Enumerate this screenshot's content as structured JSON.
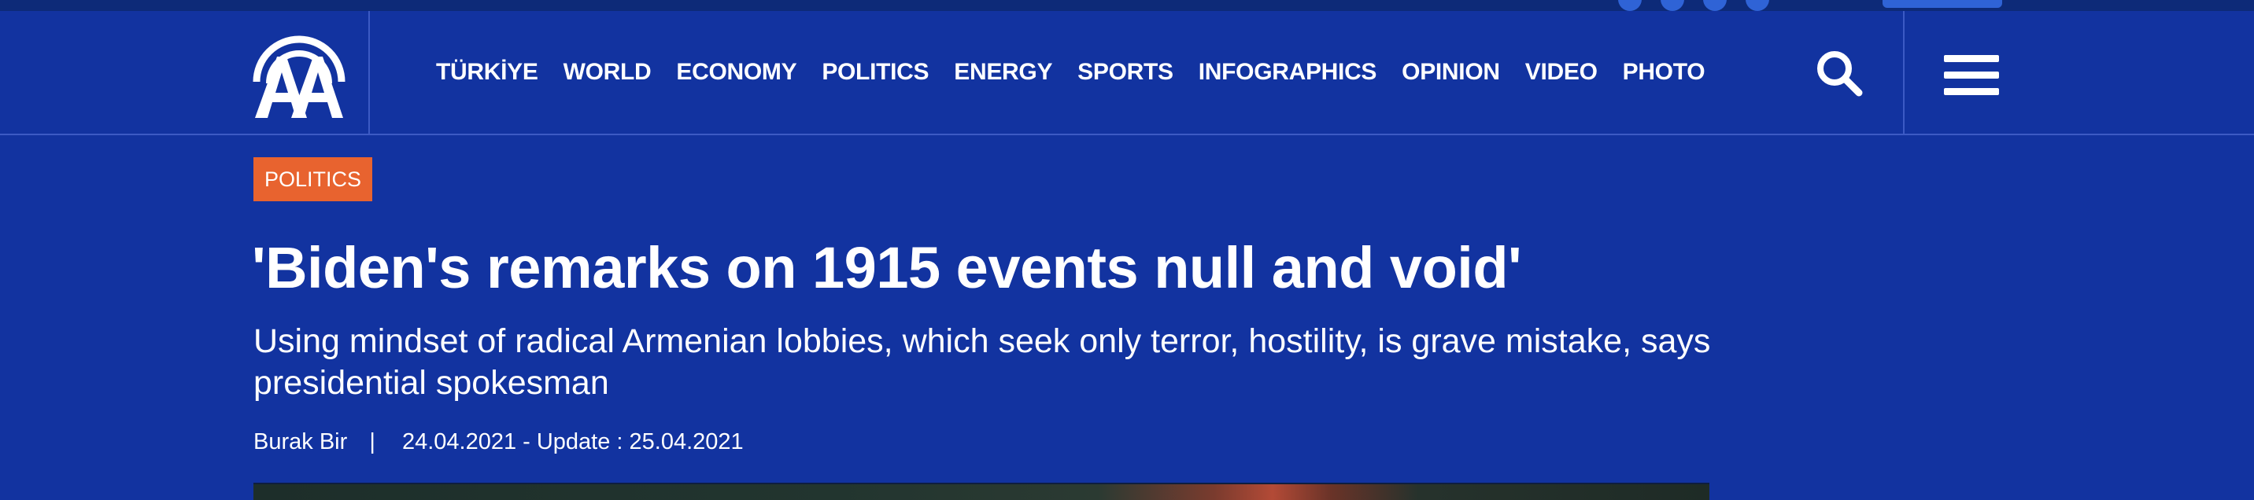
{
  "logo": {
    "text": "AA",
    "icon": "anadolu-agency-logo"
  },
  "nav": {
    "items": [
      "TÜRKİYE",
      "WORLD",
      "ECONOMY",
      "POLITICS",
      "ENERGY",
      "SPORTS",
      "INFOGRAPHICS",
      "OPINION",
      "VIDEO",
      "PHOTO"
    ]
  },
  "header": {
    "search_icon": "search-icon",
    "menu_icon": "hamburger-menu-icon"
  },
  "article": {
    "category": "POLITICS",
    "title": "'Biden's remarks on 1915 events null and void'",
    "subtitle": "Using mindset of radical Armenian lobbies, which seek only terror, hostility, is grave mistake, says presidential spokesman",
    "author": "Burak Bir",
    "separator": "|",
    "dates": "24.04.2021 - Update : 25.04.2021"
  },
  "colors": {
    "background": "#1233a0",
    "category_badge": "#e8632f",
    "divider": "#3c5ac4",
    "top_strip": "#0d2a78"
  }
}
